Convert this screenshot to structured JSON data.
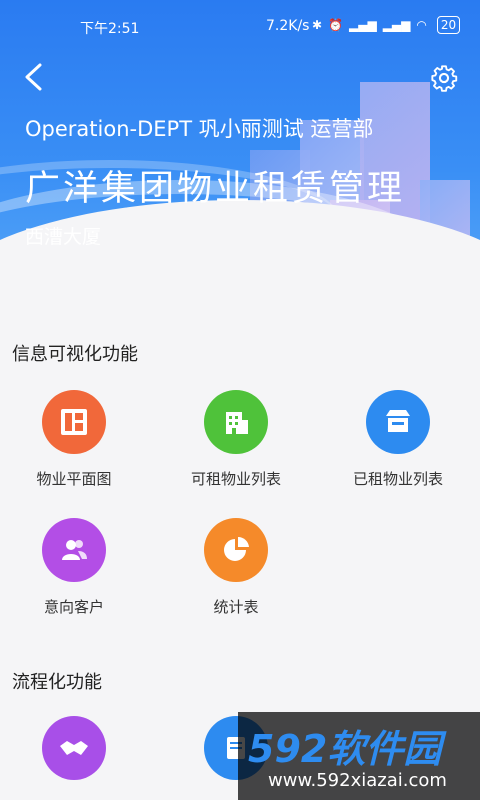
{
  "status_bar": {
    "time": "下午2:51",
    "network_speed": "7.2K/s",
    "battery": "20"
  },
  "header": {
    "subtitle": "Operation-DEPT   巩小丽测试   运营部",
    "title": "广洋集团物业租赁管理",
    "building": "西漕大厦"
  },
  "sections": {
    "visual": {
      "title": "信息可视化功能",
      "items": [
        {
          "label": "物业平面图",
          "icon": "floorplan-icon",
          "color": "#f1683a"
        },
        {
          "label": "可租物业列表",
          "icon": "building-icon",
          "color": "#4fc23a"
        },
        {
          "label": "已租物业列表",
          "icon": "store-icon",
          "color": "#2d8bf0"
        },
        {
          "label": "意向客户",
          "icon": "customers-icon",
          "color": "#b34ee6"
        },
        {
          "label": "统计表",
          "icon": "pie-chart-icon",
          "color": "#f58a2a"
        }
      ]
    },
    "process": {
      "title": "流程化功能",
      "items": [
        {
          "label": "",
          "icon": "handshake-icon",
          "color": "#a84fe8"
        },
        {
          "label": "",
          "icon": "document-icon",
          "color": "#2d8bf0"
        }
      ]
    }
  },
  "watermark": {
    "logo_text": "592软件园",
    "url": "www.592xiazai.com"
  }
}
